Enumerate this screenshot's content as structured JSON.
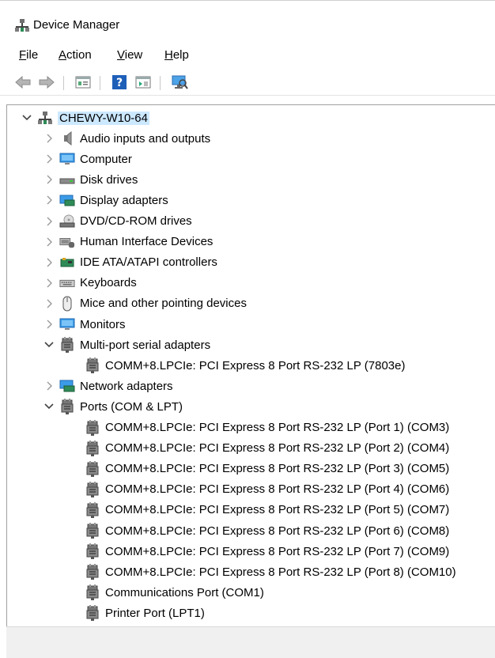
{
  "window": {
    "title": "Device Manager"
  },
  "menu": [
    {
      "label": "File",
      "key": "F",
      "rest": "ile"
    },
    {
      "label": "Action",
      "key": "A",
      "rest": "ction"
    },
    {
      "label": "View",
      "key": "V",
      "rest": "iew"
    },
    {
      "label": "Help",
      "key": "H",
      "rest": "elp"
    }
  ],
  "toolbar": [
    "back-arrow-icon",
    "forward-arrow-icon",
    "properties-icon",
    "help-icon",
    "show-hidden-icon",
    "scan-hardware-icon"
  ],
  "tree": {
    "root": "CHEWY-W10-64",
    "items": [
      {
        "label": "Audio inputs and outputs",
        "expanded": false,
        "icon": "speaker-icon"
      },
      {
        "label": "Computer",
        "expanded": false,
        "icon": "monitor-icon"
      },
      {
        "label": "Disk drives",
        "expanded": false,
        "icon": "disk-drive-icon"
      },
      {
        "label": "Display adapters",
        "expanded": false,
        "icon": "display-adapter-icon"
      },
      {
        "label": "DVD/CD-ROM drives",
        "expanded": false,
        "icon": "dvd-drive-icon"
      },
      {
        "label": "Human Interface Devices",
        "expanded": false,
        "icon": "hid-icon"
      },
      {
        "label": "IDE ATA/ATAPI controllers",
        "expanded": false,
        "icon": "ide-controller-icon"
      },
      {
        "label": "Keyboards",
        "expanded": false,
        "icon": "keyboard-icon"
      },
      {
        "label": "Mice and other pointing devices",
        "expanded": false,
        "icon": "mouse-icon"
      },
      {
        "label": "Monitors",
        "expanded": false,
        "icon": "monitor-icon"
      },
      {
        "label": "Multi-port serial adapters",
        "expanded": true,
        "icon": "serial-port-icon",
        "children": [
          "COMM+8.LPCIe: PCI Express 8 Port RS-232 LP (7803e)"
        ]
      },
      {
        "label": "Network adapters",
        "expanded": false,
        "icon": "network-adapter-icon"
      },
      {
        "label": "Ports (COM & LPT)",
        "expanded": true,
        "icon": "serial-port-icon",
        "children": [
          "COMM+8.LPCIe: PCI Express 8 Port RS-232 LP (Port 1) (COM3)",
          "COMM+8.LPCIe: PCI Express 8 Port RS-232 LP (Port 2) (COM4)",
          "COMM+8.LPCIe: PCI Express 8 Port RS-232 LP (Port 3) (COM5)",
          "COMM+8.LPCIe: PCI Express 8 Port RS-232 LP (Port 4) (COM6)",
          "COMM+8.LPCIe: PCI Express 8 Port RS-232 LP (Port 5) (COM7)",
          "COMM+8.LPCIe: PCI Express 8 Port RS-232 LP (Port 6) (COM8)",
          "COMM+8.LPCIe: PCI Express 8 Port RS-232 LP (Port 7) (COM9)",
          "COMM+8.LPCIe: PCI Express 8 Port RS-232 LP (Port 8) (COM10)",
          "Communications Port (COM1)",
          "Printer Port (LPT1)"
        ]
      }
    ]
  },
  "colors": {
    "selection": "#cce8ff",
    "statusbar": "#f0f0f0",
    "accent": "#1e88e5"
  }
}
